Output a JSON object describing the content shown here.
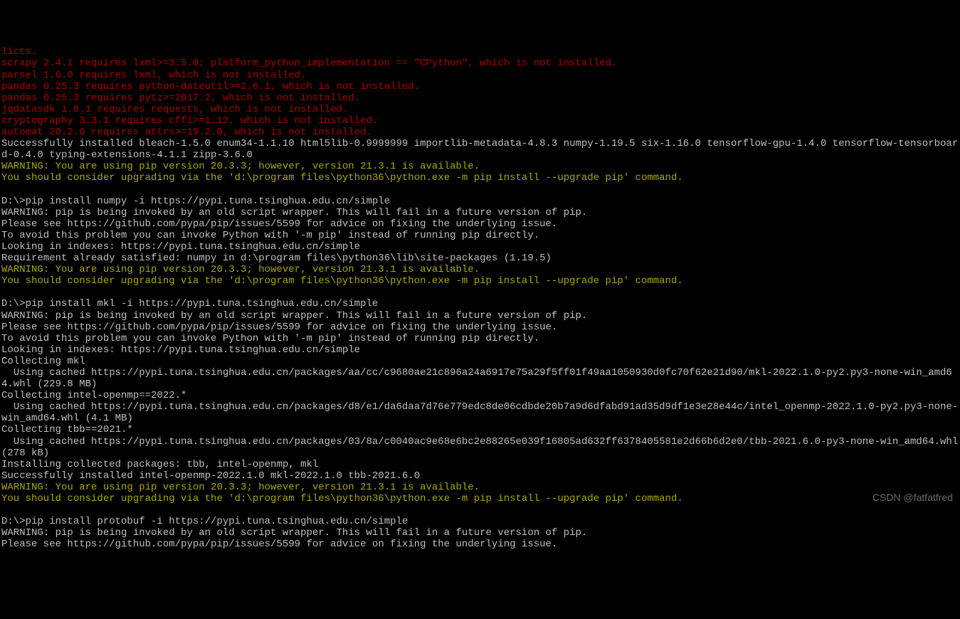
{
  "terminal": {
    "lines": [
      {
        "color": "red",
        "text": "licts."
      },
      {
        "color": "red",
        "text": "scrapy 2.4.1 requires lxml>=3.5.0; platform_python_implementation == \"CPython\", which is not installed."
      },
      {
        "color": "red",
        "text": "parsel 1.6.0 requires lxml, which is not installed."
      },
      {
        "color": "red",
        "text": "pandas 0.25.3 requires python-dateutil>=2.6.1, which is not installed."
      },
      {
        "color": "red",
        "text": "pandas 0.25.3 requires pytz>=2017.2, which is not installed."
      },
      {
        "color": "red",
        "text": "jqdatasdk 1.8.1 requires requests, which is not installed."
      },
      {
        "color": "red",
        "text": "cryptography 3.3.1 requires cffi>=1.12, which is not installed."
      },
      {
        "color": "red",
        "text": "automat 20.2.0 requires attrs>=19.2.0, which is not installed."
      },
      {
        "color": "white",
        "text": "Successfully installed bleach-1.5.0 enum34-1.1.10 html5lib-0.9999999 importlib-metadata-4.8.3 numpy-1.19.5 six-1.16.0 tensorflow-gpu-1.4.0 tensorflow-tensorboard-0.4.0 typing-extensions-4.1.1 zipp-3.6.0"
      },
      {
        "color": "yellow",
        "text": "WARNING: You are using pip version 20.3.3; however, version 21.3.1 is available."
      },
      {
        "color": "yellow",
        "text": "You should consider upgrading via the 'd:\\program files\\python36\\python.exe -m pip install --upgrade pip' command."
      },
      {
        "color": "white",
        "text": ""
      },
      {
        "color": "white",
        "text": "D:\\>pip install numpy -i https://pypi.tuna.tsinghua.edu.cn/simple"
      },
      {
        "color": "white",
        "text": "WARNING: pip is being invoked by an old script wrapper. This will fail in a future version of pip."
      },
      {
        "color": "white",
        "text": "Please see https://github.com/pypa/pip/issues/5599 for advice on fixing the underlying issue."
      },
      {
        "color": "white",
        "text": "To avoid this problem you can invoke Python with '-m pip' instead of running pip directly."
      },
      {
        "color": "white",
        "text": "Looking in indexes: https://pypi.tuna.tsinghua.edu.cn/simple"
      },
      {
        "color": "white",
        "text": "Requirement already satisfied: numpy in d:\\program files\\python36\\lib\\site-packages (1.19.5)"
      },
      {
        "color": "yellow",
        "text": "WARNING: You are using pip version 20.3.3; however, version 21.3.1 is available."
      },
      {
        "color": "yellow",
        "text": "You should consider upgrading via the 'd:\\program files\\python36\\python.exe -m pip install --upgrade pip' command."
      },
      {
        "color": "white",
        "text": ""
      },
      {
        "color": "white",
        "text": "D:\\>pip install mkl -i https://pypi.tuna.tsinghua.edu.cn/simple"
      },
      {
        "color": "white",
        "text": "WARNING: pip is being invoked by an old script wrapper. This will fail in a future version of pip."
      },
      {
        "color": "white",
        "text": "Please see https://github.com/pypa/pip/issues/5599 for advice on fixing the underlying issue."
      },
      {
        "color": "white",
        "text": "To avoid this problem you can invoke Python with '-m pip' instead of running pip directly."
      },
      {
        "color": "white",
        "text": "Looking in indexes: https://pypi.tuna.tsinghua.edu.cn/simple"
      },
      {
        "color": "white",
        "text": "Collecting mkl"
      },
      {
        "color": "white",
        "text": "  Using cached https://pypi.tuna.tsinghua.edu.cn/packages/aa/cc/c9680ae21c896a24a6917e75a29f5ff01f49aa1050930d0fc70f62e21d90/mkl-2022.1.0-py2.py3-none-win_amd64.whl (229.8 MB)"
      },
      {
        "color": "white",
        "text": "Collecting intel-openmp==2022.*"
      },
      {
        "color": "white",
        "text": "  Using cached https://pypi.tuna.tsinghua.edu.cn/packages/d8/e1/da6daa7d76e779edc8de06cdbde20b7a9d6dfabd91ad35d9df1e3e28e44c/intel_openmp-2022.1.0-py2.py3-none-win_amd64.whl (4.1 MB)"
      },
      {
        "color": "white",
        "text": "Collecting tbb==2021.*"
      },
      {
        "color": "white",
        "text": "  Using cached https://pypi.tuna.tsinghua.edu.cn/packages/03/8a/c0040ac9e68e6bc2e88265e039f16805ad632ff6378405581e2d66b6d2e0/tbb-2021.6.0-py3-none-win_amd64.whl (278 kB)"
      },
      {
        "color": "white",
        "text": "Installing collected packages: tbb, intel-openmp, mkl"
      },
      {
        "color": "white",
        "text": "Successfully installed intel-openmp-2022.1.0 mkl-2022.1.0 tbb-2021.6.0"
      },
      {
        "color": "yellow",
        "text": "WARNING: You are using pip version 20.3.3; however, version 21.3.1 is available."
      },
      {
        "color": "yellow",
        "text": "You should consider upgrading via the 'd:\\program files\\python36\\python.exe -m pip install --upgrade pip' command."
      },
      {
        "color": "white",
        "text": ""
      },
      {
        "color": "white",
        "text": "D:\\>pip install protobuf -i https://pypi.tuna.tsinghua.edu.cn/simple"
      },
      {
        "color": "white",
        "text": "WARNING: pip is being invoked by an old script wrapper. This will fail in a future version of pip."
      },
      {
        "color": "white",
        "text": "Please see https://github.com/pypa/pip/issues/5599 for advice on fixing the underlying issue."
      }
    ]
  },
  "watermark": "CSDN @fatfatfred"
}
